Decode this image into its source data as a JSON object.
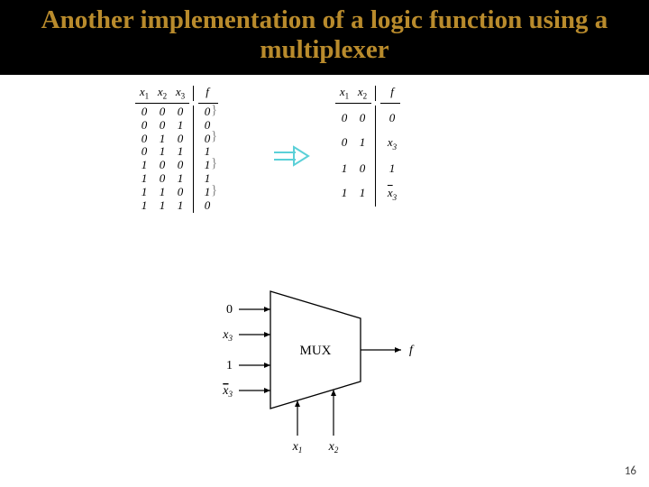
{
  "title": "Another implementation of a logic function using a multiplexer",
  "table1": {
    "headers": [
      "x₁",
      "x₂",
      "x₃",
      "f"
    ],
    "rows": [
      [
        "0",
        "0",
        "0",
        "0"
      ],
      [
        "0",
        "0",
        "1",
        "0"
      ],
      [
        "0",
        "1",
        "0",
        "0"
      ],
      [
        "0",
        "1",
        "1",
        "1"
      ],
      [
        "1",
        "0",
        "0",
        "1"
      ],
      [
        "1",
        "0",
        "1",
        "1"
      ],
      [
        "1",
        "1",
        "0",
        "1"
      ],
      [
        "1",
        "1",
        "1",
        "0"
      ]
    ]
  },
  "table2": {
    "headers": [
      "x₁",
      "x₂",
      "f"
    ],
    "rows": [
      [
        "0",
        "0",
        "0"
      ],
      [
        "0",
        "1",
        "x₃"
      ],
      [
        "1",
        "0",
        "1"
      ],
      [
        "1",
        "1",
        "x̄₃"
      ]
    ]
  },
  "mux": {
    "label": "MUX",
    "inputs": [
      "0",
      "x₃",
      "1",
      "x̄₃"
    ],
    "selects": [
      "x₁",
      "x₂"
    ],
    "output": "f"
  },
  "braces": [
    "}",
    "}",
    "}",
    "}"
  ],
  "page_number": "16",
  "chart_data": {
    "type": "table",
    "description": "Truth table reduction for implementing f with a 4-to-1 multiplexer using x1,x2 as selects",
    "full_truth_table": {
      "inputs": [
        "x1",
        "x2",
        "x3"
      ],
      "output": "f",
      "rows": [
        [
          0,
          0,
          0,
          0
        ],
        [
          0,
          0,
          1,
          0
        ],
        [
          0,
          1,
          0,
          0
        ],
        [
          0,
          1,
          1,
          1
        ],
        [
          1,
          0,
          0,
          1
        ],
        [
          1,
          0,
          1,
          1
        ],
        [
          1,
          1,
          0,
          1
        ],
        [
          1,
          1,
          1,
          0
        ]
      ]
    },
    "reduced_table": {
      "selects": [
        "x1",
        "x2"
      ],
      "data_input_for_f": {
        "00": "0",
        "01": "x3",
        "10": "1",
        "11": "not x3"
      }
    },
    "mux_block": {
      "data_inputs": [
        "0",
        "x3",
        "1",
        "not x3"
      ],
      "select_inputs": [
        "x1",
        "x2"
      ],
      "output": "f"
    }
  }
}
